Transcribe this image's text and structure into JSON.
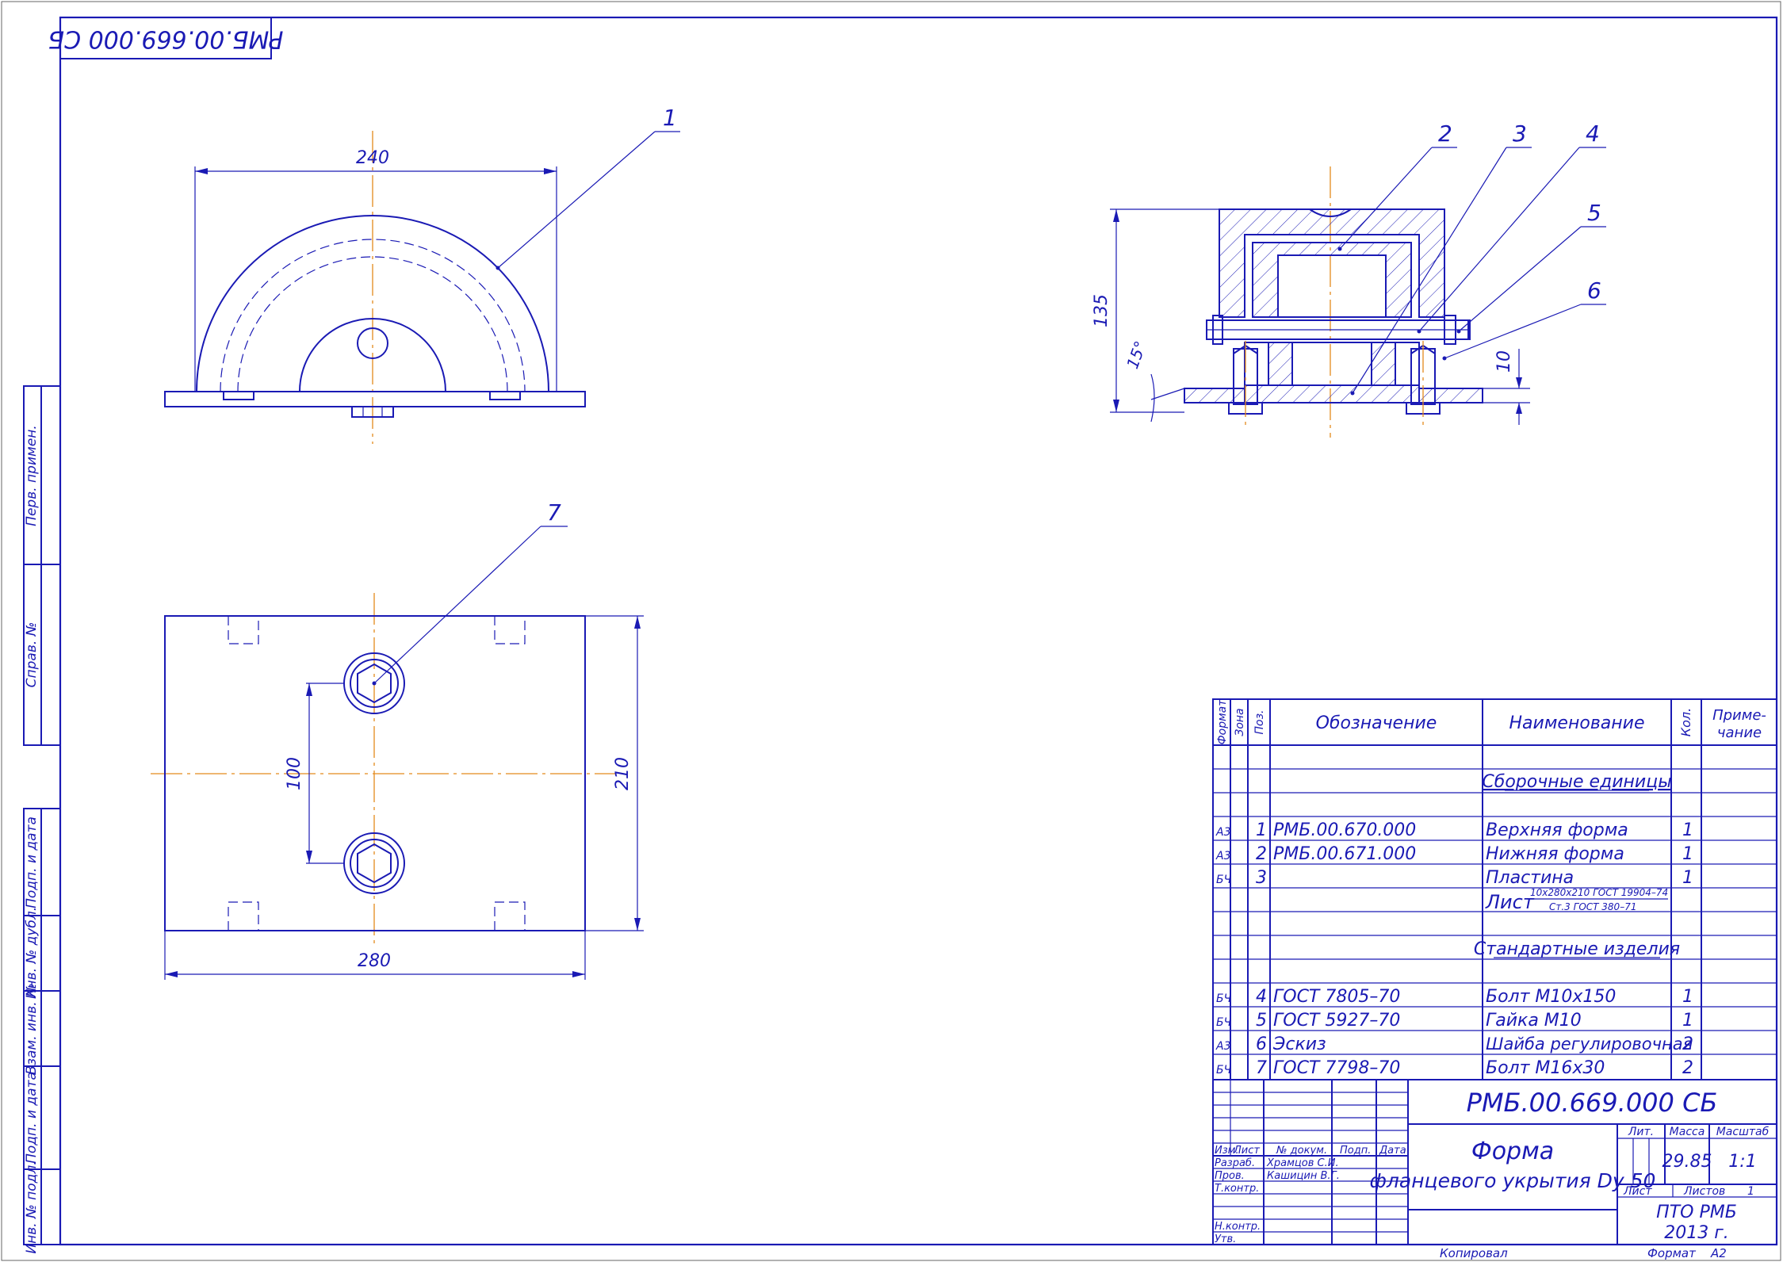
{
  "stamp_code": "РМБ.00.669.000 СБ",
  "side_labels": [
    "Перв. примен.",
    "Справ. №",
    "Подп. и дата",
    "Инв. № дубл.",
    "Взам. инв. №",
    "Подп. и дата",
    "Инв. № подл."
  ],
  "dims": {
    "d240": "240",
    "d280": "280",
    "d210": "210",
    "d100": "100",
    "d135": "135",
    "d10": "10",
    "d15": "15°"
  },
  "leaders": [
    "1",
    "2",
    "3",
    "4",
    "5",
    "6",
    "7"
  ],
  "spec": {
    "headers": {
      "format": "Формат",
      "zone": "Зона",
      "pos": "Поз.",
      "designation": "Обозначение",
      "name": "Наименование",
      "qty": "Кол.",
      "note": "Приме-\nчание"
    },
    "note_line1": "Приме-",
    "note_line2": "чание",
    "section1": "Сборочные единицы",
    "section2": "Стандартные изделия",
    "rows": [
      {
        "format": "А3",
        "pos": "1",
        "designation": "РМБ.00.670.000",
        "name": "Верхняя форма",
        "qty": "1"
      },
      {
        "format": "А3",
        "pos": "2",
        "designation": "РМБ.00.671.000",
        "name": "Нижняя форма",
        "qty": "1"
      },
      {
        "format": "БЧ",
        "pos": "3",
        "designation": "",
        "name": "Пластина",
        "qty": "1"
      }
    ],
    "sheet_word": "Лист",
    "sheet_top": "10х280х210 ГОСТ 19904–74",
    "sheet_bottom": "Ст.3 ГОСТ 380–71",
    "rows2": [
      {
        "format": "БЧ",
        "pos": "4",
        "designation": "ГОСТ 7805–70",
        "name": "Болт М10х150",
        "qty": "1"
      },
      {
        "format": "БЧ",
        "pos": "5",
        "designation": "ГОСТ 5927–70",
        "name": "Гайка М10",
        "qty": "1"
      },
      {
        "format": "А3",
        "pos": "6",
        "designation": "Эскиз",
        "name": "Шайба регулировочная",
        "qty": "2"
      },
      {
        "format": "БЧ",
        "pos": "7",
        "designation": "ГОСТ 7798–70",
        "name": "Болт М16х30",
        "qty": "2"
      }
    ]
  },
  "title_block": {
    "code": "РМБ.00.669.000 СБ",
    "title1": "Форма",
    "title2": "фланцевого укрытия Dy 50",
    "izm": "Изм.",
    "list": "Лист",
    "ndoc": "№ докум.",
    "podp": "Подп.",
    "data": "Дата",
    "razrab": "Разраб.",
    "razrab_name": "Храмцов С.И.",
    "prov": "Пров.",
    "prov_name": "Кашицин В.Г.",
    "tkontr": "Т.контр.",
    "nkontr": "Н.контр.",
    "utv": "Утв.",
    "lit": "Лит.",
    "massa": "Масса",
    "masshtab": "Масштаб",
    "mass_val": "29.85",
    "scale_val": "1:1",
    "sheet": "Лист",
    "sheets": "Листов",
    "sheets_val": "1",
    "org1": "ПТО РМБ",
    "org2": "2013 г.",
    "kopiroval": "Копировал",
    "format": "Формат",
    "format_val": "А2"
  }
}
